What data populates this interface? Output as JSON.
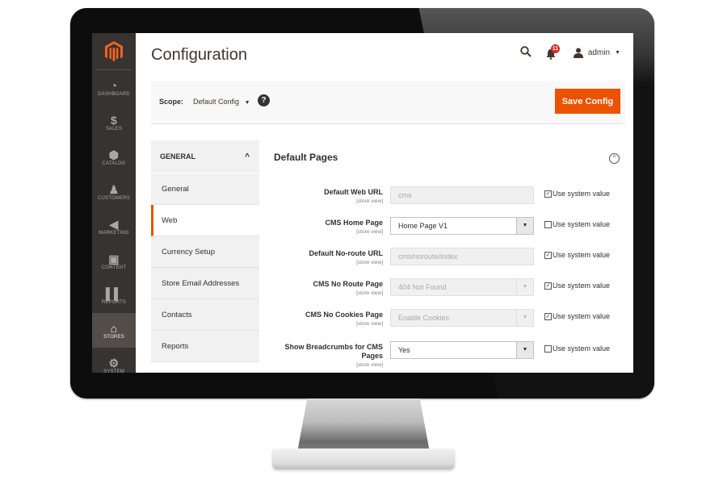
{
  "header": {
    "title": "Configuration",
    "notifications_count": "11",
    "user_label": "admin"
  },
  "nav": {
    "items": [
      {
        "label": "DASHBOARD",
        "icon": "dashboard-icon",
        "glyph": "◔"
      },
      {
        "label": "SALES",
        "icon": "dollar-icon",
        "glyph": "$"
      },
      {
        "label": "CATALOG",
        "icon": "box-icon",
        "glyph": "⬢"
      },
      {
        "label": "CUSTOMERS",
        "icon": "person-icon",
        "glyph": "♟"
      },
      {
        "label": "MARKETING",
        "icon": "megaphone-icon",
        "glyph": "◀"
      },
      {
        "label": "CONTENT",
        "icon": "layout-icon",
        "glyph": "▣"
      },
      {
        "label": "REPORTS",
        "icon": "bar-chart-icon",
        "glyph": "▌▌"
      },
      {
        "label": "STORES",
        "icon": "store-icon",
        "glyph": "⌂"
      },
      {
        "label": "SYSTEM",
        "icon": "gear-icon",
        "glyph": "⚙"
      }
    ]
  },
  "scope": {
    "label": "Scope:",
    "value": "Default Config"
  },
  "toolbar": {
    "save_label": "Save Config"
  },
  "tabs": {
    "group_title": "GENERAL",
    "items": [
      {
        "label": "General"
      },
      {
        "label": "Web"
      },
      {
        "label": "Currency Setup"
      },
      {
        "label": "Store Email Addresses"
      },
      {
        "label": "Contacts"
      },
      {
        "label": "Reports"
      }
    ]
  },
  "section": {
    "title": "Default Pages",
    "scope_hint": "[store view]",
    "system_value_label": "Use system value",
    "fields": [
      {
        "label": "Default Web URL",
        "type": "text",
        "value": "cms",
        "disabled": true,
        "use_system": true
      },
      {
        "label": "CMS Home Page",
        "type": "select",
        "value": "Home Page V1",
        "disabled": false,
        "use_system": false
      },
      {
        "label": "Default No-route URL",
        "type": "text",
        "value": "cms/noroute/index",
        "disabled": true,
        "use_system": true
      },
      {
        "label": "CMS No Route Page",
        "type": "select",
        "value": "404 Not Found",
        "disabled": true,
        "use_system": true
      },
      {
        "label": "CMS No Cookies Page",
        "type": "select",
        "value": "Enable Cookies",
        "disabled": true,
        "use_system": true
      },
      {
        "label": "Show Breadcrumbs for CMS Pages",
        "type": "select",
        "value": "Yes",
        "disabled": false,
        "use_system": false
      }
    ]
  },
  "colors": {
    "accent": "#eb5202",
    "nav_bg": "#373330",
    "badge": "#e22626"
  }
}
